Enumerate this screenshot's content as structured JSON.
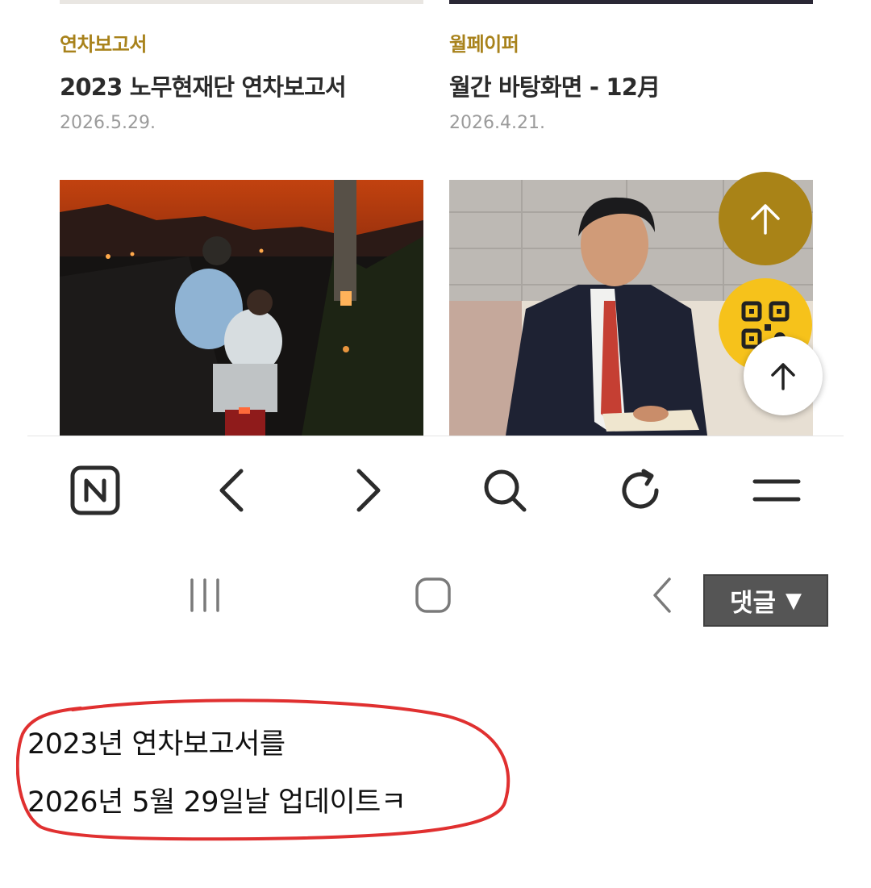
{
  "cards": [
    {
      "category": "연차보고서",
      "title": "2023 노무현재단 연차보고서",
      "date": "2026.5.29."
    },
    {
      "category": "월페이퍼",
      "title": "월간 바탕화면 - 12月",
      "date": "2026.4.21."
    }
  ],
  "photos": [
    {
      "description_icon": "dusk-motorbike-photo"
    },
    {
      "description_icon": "man-reading-photo"
    }
  ],
  "floating_buttons": [
    {
      "icon": "arrow-up-icon",
      "color": "#a98317"
    },
    {
      "icon": "qr-code-icon",
      "color": "#f6c21b"
    },
    {
      "icon": "arrow-up-icon",
      "color": "#ffffff"
    }
  ],
  "browser_toolbar": {
    "items": [
      "naver-home-icon",
      "back-icon",
      "forward-icon",
      "search-icon",
      "refresh-icon",
      "menu-icon"
    ]
  },
  "system_nav": {
    "items": [
      "recent-apps-icon",
      "home-icon",
      "back-icon"
    ]
  },
  "comment_button": {
    "label": "댓글",
    "arrow": "▼"
  },
  "annotation": {
    "line1": "2023년 연차보고서를",
    "line2": "2026년 5월 29일날 업데이트ㅋ",
    "circle_color": "#e03030"
  }
}
